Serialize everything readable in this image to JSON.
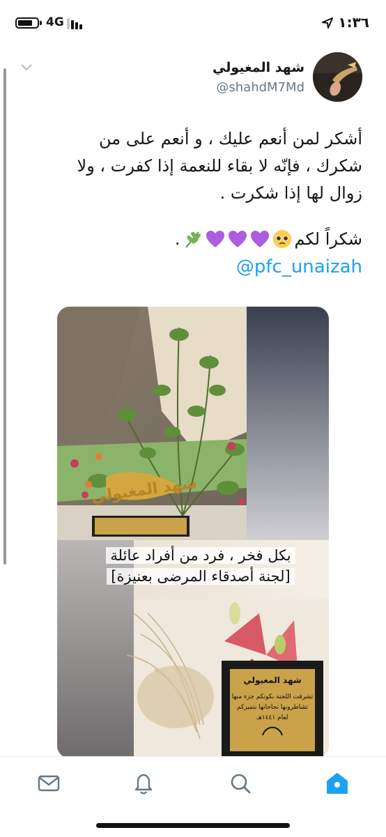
{
  "status_bar": {
    "network": "4G",
    "time": "١:٣٦"
  },
  "tweet": {
    "author_name": "شهد المغيولي",
    "author_handle": "@shahdM7Md",
    "text_lines": [
      "أشكر لمن أنعم عليك ، و أنعم على من",
      "شكرك ، فإنّه لا بقاء للنعمة إذا كفرت ، ولا",
      "زوال لها إذا شكرت ."
    ],
    "thanks": "شكراً لكم",
    "thanks_emojis": [
      "pleading-face",
      "purple-heart",
      "purple-heart",
      "purple-heart",
      "herb-leaf"
    ],
    "mention": "@pfc_unaizah",
    "media": {
      "caption_line1": "بكل فخر ، فرد من أفراد عائلة",
      "caption_line2": "[لجنة أصدقاء المرضى بعنيزة]",
      "trophy_text": "شهد المغيولي",
      "plaque_title": "شهد المغيولي",
      "plaque_line1": "تشرفت اللجنة بكونكم جزء منها",
      "plaque_line2": "تشاطرونها نجاحاتها بتميزكم",
      "plaque_line3": "لعام ١٤٤١هـ"
    }
  },
  "tabbar": {
    "tabs": [
      "messages",
      "notifications",
      "search",
      "home"
    ],
    "active": "home",
    "accent": "#1da1f2"
  }
}
